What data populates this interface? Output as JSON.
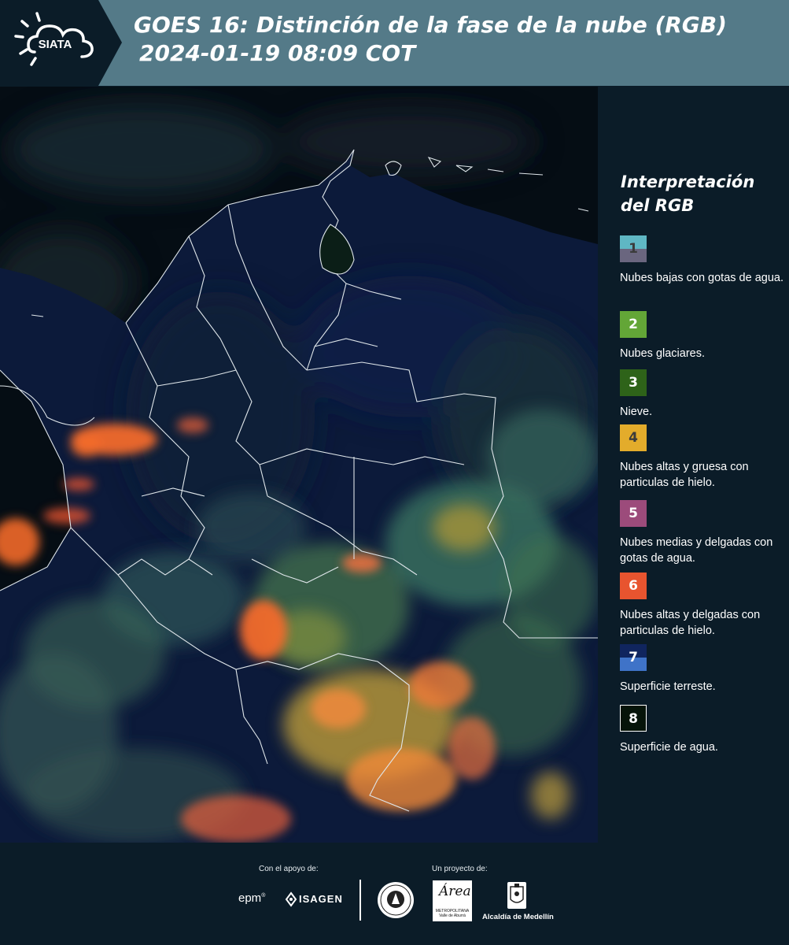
{
  "header": {
    "logo_text": "SIATA",
    "title_line1": "GOES 16: Distinción de la fase de la nube (RGB)",
    "title_line2": "2024-01-19 08:09 COT"
  },
  "legend": {
    "title": "Interpretación del RGB",
    "items": [
      {
        "number": "1",
        "label": "Nubes bajas con gotas de agua.",
        "color_top": "#5fb7c4",
        "color_bottom": "#6a667f",
        "text_color": "#3b3b3b"
      },
      {
        "number": "2",
        "label": "Nubes glaciares.",
        "color_top": "#63a637",
        "color_bottom": "#63a637",
        "text_color": "#ffffff"
      },
      {
        "number": "3",
        "label": "Nieve.",
        "color_top": "#2e6319",
        "color_bottom": "#2e6319",
        "text_color": "#ffffff"
      },
      {
        "number": "4",
        "label": "Nubes altas y gruesa con particulas de hielo.",
        "color_top": "#e3ac2b",
        "color_bottom": "#e3ac2b",
        "text_color": "#3b3b3b"
      },
      {
        "number": "5",
        "label": "Nubes medias y delgadas con gotas de agua.",
        "color_top": "#9c4b7b",
        "color_bottom": "#9c4b7b",
        "text_color": "#ffffff"
      },
      {
        "number": "6",
        "label": "Nubes altas y delgadas con particulas de hielo.",
        "color_top": "#e8542f",
        "color_bottom": "#e8542f",
        "text_color": "#ffffff"
      },
      {
        "number": "7",
        "label": "Superficie terreste.",
        "color_top": "#10255e",
        "color_bottom": "#3f73c8",
        "text_color": "#ffffff"
      },
      {
        "number": "8",
        "label": "Superficie de agua.",
        "color_top": "#061409",
        "color_bottom": "#061409",
        "text_color": "#ffffff"
      }
    ]
  },
  "footer": {
    "support_label": "Con el apoyo de:",
    "project_label": "Un proyecto de:",
    "sponsor1": "epm",
    "sponsor2": "ISAGEN",
    "area_logo_script": "Área",
    "area_logo_sub": "METROPOLITANA Valle de Aburrá",
    "alcaldia": "Alcaldía de Medellín"
  },
  "colors": {
    "header_bg": "#547a88",
    "page_bg": "#0b1c28",
    "cloud_orange": "#f26a2a",
    "cloud_yellow": "#e3ac2b",
    "cloud_green": "#5aa15a",
    "land_dark": "#0c1833"
  }
}
